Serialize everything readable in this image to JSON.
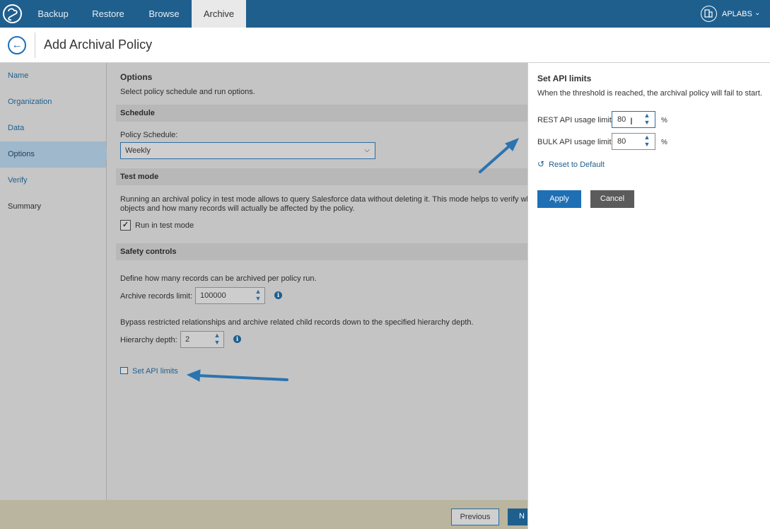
{
  "nav": {
    "tabs": [
      "Backup",
      "Restore",
      "Browse",
      "Archive"
    ],
    "active_tab": "Archive",
    "org_label": "APLABS"
  },
  "header": {
    "title": "Add Archival Policy"
  },
  "sidebar": {
    "items": [
      "Name",
      "Organization",
      "Data",
      "Options",
      "Verify",
      "Summary"
    ],
    "active": "Options"
  },
  "options": {
    "title": "Options",
    "subtitle": "Select policy schedule and run options.",
    "schedule_header": "Schedule",
    "policy_schedule_label": "Policy Schedule:",
    "policy_schedule_value": "Weekly",
    "test_mode_header": "Test mode",
    "test_mode_desc_1": "Running an archival policy in test mode allows to query Salesforce data without deleting it. This mode helps to verify which",
    "test_mode_desc_2": "objects and how many records will actually be affected by the policy.",
    "test_mode_checkbox_label": "Run in test mode",
    "test_mode_checked": true,
    "safety_header": "Safety controls",
    "records_desc": "Define how many records can be archived per policy run.",
    "records_label": "Archive records limit:",
    "records_value": "100000",
    "hierarchy_desc": "Bypass restricted relationships and archive related child records down to the specified hierarchy depth.",
    "hierarchy_label": "Hierarchy depth:",
    "hierarchy_value": "2",
    "api_link": "Set API limits"
  },
  "footer": {
    "previous": "Previous",
    "next": "N"
  },
  "panel": {
    "title": "Set API limits",
    "description": "When the threshold is reached, the archival policy will fail to start.",
    "rest_label": "REST API usage limit:",
    "rest_value": "80",
    "bulk_label": "BULK API usage limit:",
    "bulk_value": "80",
    "unit": "%",
    "reset": "Reset to Default",
    "apply": "Apply",
    "cancel": "Cancel"
  },
  "colors": {
    "brand": "#1f5f8e",
    "accent": "#1f6fb5",
    "annotation_arrow": "#2b74b0"
  },
  "icons": {
    "logo": "cloud-logo-icon",
    "org": "building-icon",
    "back": "arrow-left-icon",
    "info": "info-icon",
    "reset": "undo-icon"
  }
}
